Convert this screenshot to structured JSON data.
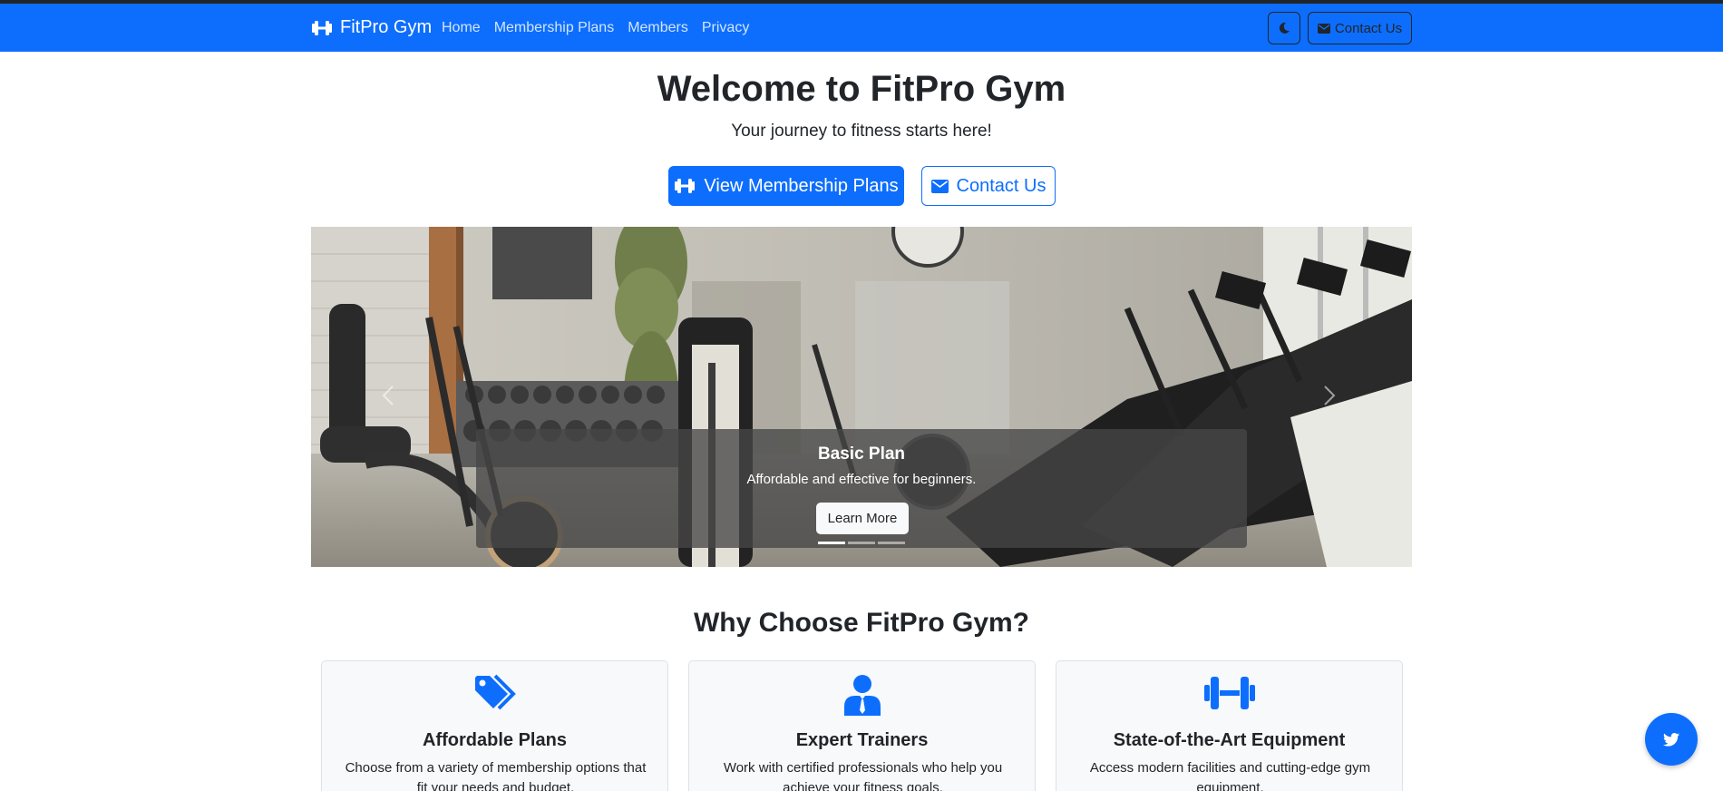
{
  "colors": {
    "primary": "#0d6efd",
    "dark": "#212529",
    "light": "#f8f9fa"
  },
  "navbar": {
    "brand": "FitPro Gym",
    "brand_icon": "dumbbell-icon",
    "links": [
      "Home",
      "Membership Plans",
      "Members",
      "Privacy"
    ],
    "theme_toggle_icon": "moon-icon",
    "contact_label": "Contact Us",
    "contact_icon": "envelope-icon"
  },
  "hero": {
    "title": "Welcome to FitPro Gym",
    "subtitle": "Your journey to fitness starts here!",
    "primary_button": "View Membership Plans",
    "secondary_button": "Contact Us"
  },
  "carousel": {
    "active_index": 0,
    "slide_count": 3,
    "caption_title": "Basic Plan",
    "caption_text": "Affordable and effective for beginners.",
    "caption_button": "Learn More"
  },
  "why": {
    "title": "Why Choose FitPro Gym?",
    "cards": [
      {
        "icon": "tags-icon",
        "title": "Affordable Plans",
        "text": "Choose from a variety of membership options that fit your needs and budget."
      },
      {
        "icon": "trainer-icon",
        "title": "Expert Trainers",
        "text": "Work with certified professionals who help you achieve your fitness goals."
      },
      {
        "icon": "dumbbell-icon",
        "title": "State-of-the-Art Equipment",
        "text": "Access modern facilities and cutting-edge gym equipment."
      }
    ]
  },
  "social": {
    "twitter_icon": "twitter-icon"
  }
}
